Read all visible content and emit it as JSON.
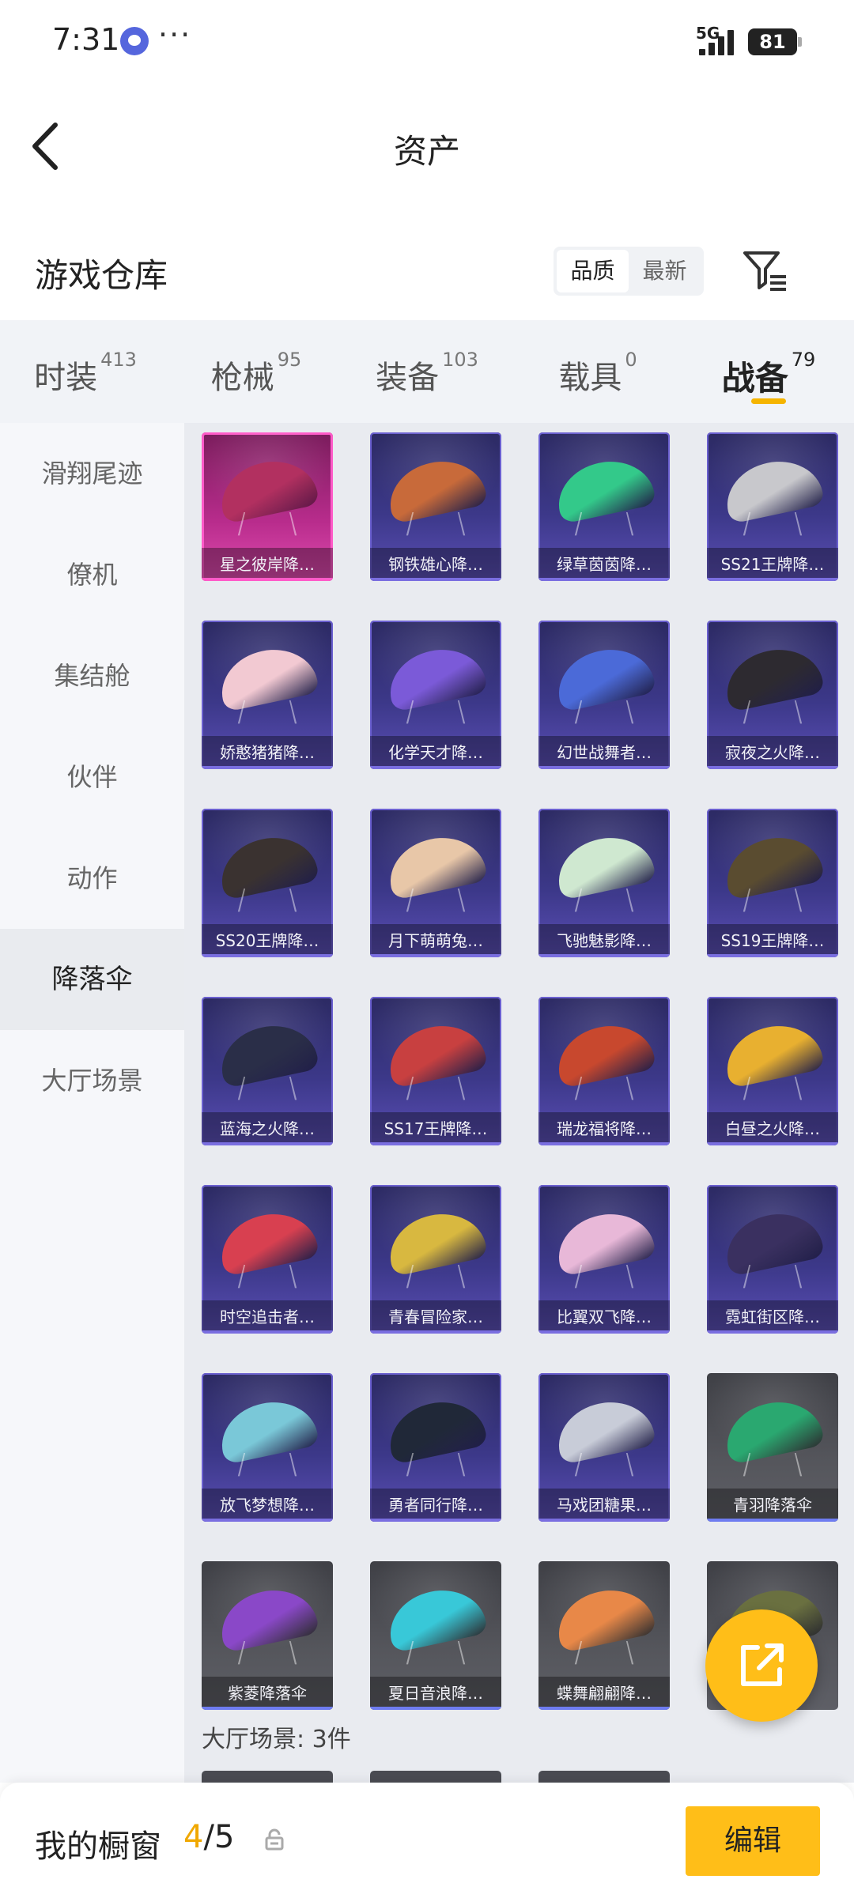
{
  "status_bar": {
    "time": "7:31",
    "dots": "···",
    "network": "5G",
    "battery": "81"
  },
  "nav": {
    "title": "资产"
  },
  "warehouse": {
    "title": "游戏仓库",
    "sort_options": [
      "品质",
      "最新"
    ],
    "active_sort": "品质"
  },
  "tabs": [
    {
      "name": "时装",
      "count": "413"
    },
    {
      "name": "枪械",
      "count": "95"
    },
    {
      "name": "装备",
      "count": "103"
    },
    {
      "name": "载具",
      "count": "0"
    },
    {
      "name": "战备",
      "count": "79"
    }
  ],
  "active_tab": "战备",
  "side_nav": [
    "滑翔尾迹",
    "僚机",
    "集结舱",
    "伙伴",
    "动作",
    "降落伞",
    "大厅场景"
  ],
  "active_side": "降落伞",
  "items": [
    {
      "label": "星之彼岸降…",
      "style": "pink",
      "color": "#b23060"
    },
    {
      "label": "钢铁雄心降…",
      "style": "purple",
      "color": "#c86a3a"
    },
    {
      "label": "绿草茵茵降…",
      "style": "purple",
      "color": "#33c98a"
    },
    {
      "label": "SS21王牌降…",
      "style": "purple",
      "color": "#c8c8cc"
    },
    {
      "label": "娇憨猪猪降…",
      "style": "purple",
      "color": "#f2c9d2"
    },
    {
      "label": "化学天才降…",
      "style": "purple",
      "color": "#7b5ad8"
    },
    {
      "label": "幻世战舞者…",
      "style": "purple",
      "color": "#4b6ad8"
    },
    {
      "label": "寂夜之火降…",
      "style": "purple",
      "color": "#2d2a30"
    },
    {
      "label": "SS20王牌降…",
      "style": "purple",
      "color": "#3a3230"
    },
    {
      "label": "月下萌萌兔…",
      "style": "purple",
      "color": "#e8c7a8"
    },
    {
      "label": "飞驰魅影降…",
      "style": "purple",
      "color": "#cfe8d0"
    },
    {
      "label": "SS19王牌降…",
      "style": "purple",
      "color": "#5a4c30"
    },
    {
      "label": "蓝海之火降…",
      "style": "purple",
      "color": "#2a2e48"
    },
    {
      "label": "SS17王牌降…",
      "style": "purple",
      "color": "#c84040"
    },
    {
      "label": "瑞龙福将降…",
      "style": "purple",
      "color": "#c8482e"
    },
    {
      "label": "白昼之火降…",
      "style": "purple",
      "color": "#e8b030"
    },
    {
      "label": "时空追击者…",
      "style": "purple",
      "color": "#d84050"
    },
    {
      "label": "青春冒险家…",
      "style": "purple",
      "color": "#d8b840"
    },
    {
      "label": "比翼双飞降…",
      "style": "purple",
      "color": "#e8b8d8"
    },
    {
      "label": "霓虹街区降…",
      "style": "purple",
      "color": "#3a3060"
    },
    {
      "label": "放飞梦想降…",
      "style": "purple",
      "color": "#7ac8d8"
    },
    {
      "label": "勇者同行降…",
      "style": "purple",
      "color": "#202838"
    },
    {
      "label": "马戏团糖果…",
      "style": "purple",
      "color": "#c8ccd8"
    },
    {
      "label": "青羽降落伞",
      "style": "gray",
      "color": "#2aa870"
    },
    {
      "label": "紫菱降落伞",
      "style": "gray",
      "color": "#8a48c8"
    },
    {
      "label": "夏日音浪降…",
      "style": "gray",
      "color": "#38c8d8"
    },
    {
      "label": "蝶舞翩翩降…",
      "style": "gray",
      "color": "#e88848"
    },
    {
      "label": "",
      "style": "gray",
      "color": "#6a7040"
    }
  ],
  "section_label": "大厅场景: 3件",
  "showcase": {
    "label": "我的橱窗",
    "current": "4",
    "max": "5"
  },
  "edit_label": "编辑",
  "colors": {
    "accent": "#ffbe18",
    "tab_underline": "#f5b400",
    "count_highlight": "#f0a800"
  }
}
